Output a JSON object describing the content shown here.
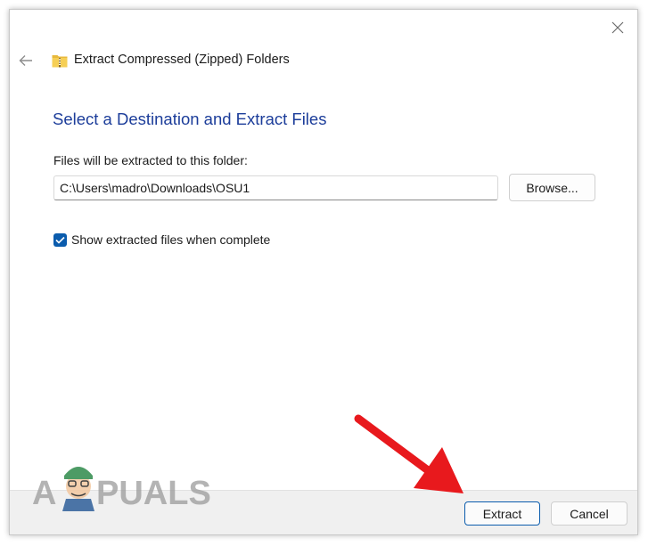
{
  "window": {
    "title": "Extract Compressed (Zipped) Folders"
  },
  "main": {
    "heading": "Select a Destination and Extract Files",
    "destination_label": "Files will be extracted to this folder:",
    "destination_path": "C:\\Users\\madro\\Downloads\\OSU1",
    "browse_label": "Browse...",
    "show_files_label": "Show extracted files when complete",
    "show_files_checked": true
  },
  "footer": {
    "extract_label": "Extract",
    "cancel_label": "Cancel"
  },
  "watermark": {
    "text": "APPUALS"
  },
  "colors": {
    "heading": "#1c3d9a",
    "accent": "#0b5cad",
    "arrow": "#e8191d",
    "footer_bg": "#f0f0f0"
  },
  "icons": {
    "close": "close-icon",
    "back": "back-arrow-icon",
    "zip": "zip-folder-icon",
    "check": "checkmark-icon"
  }
}
